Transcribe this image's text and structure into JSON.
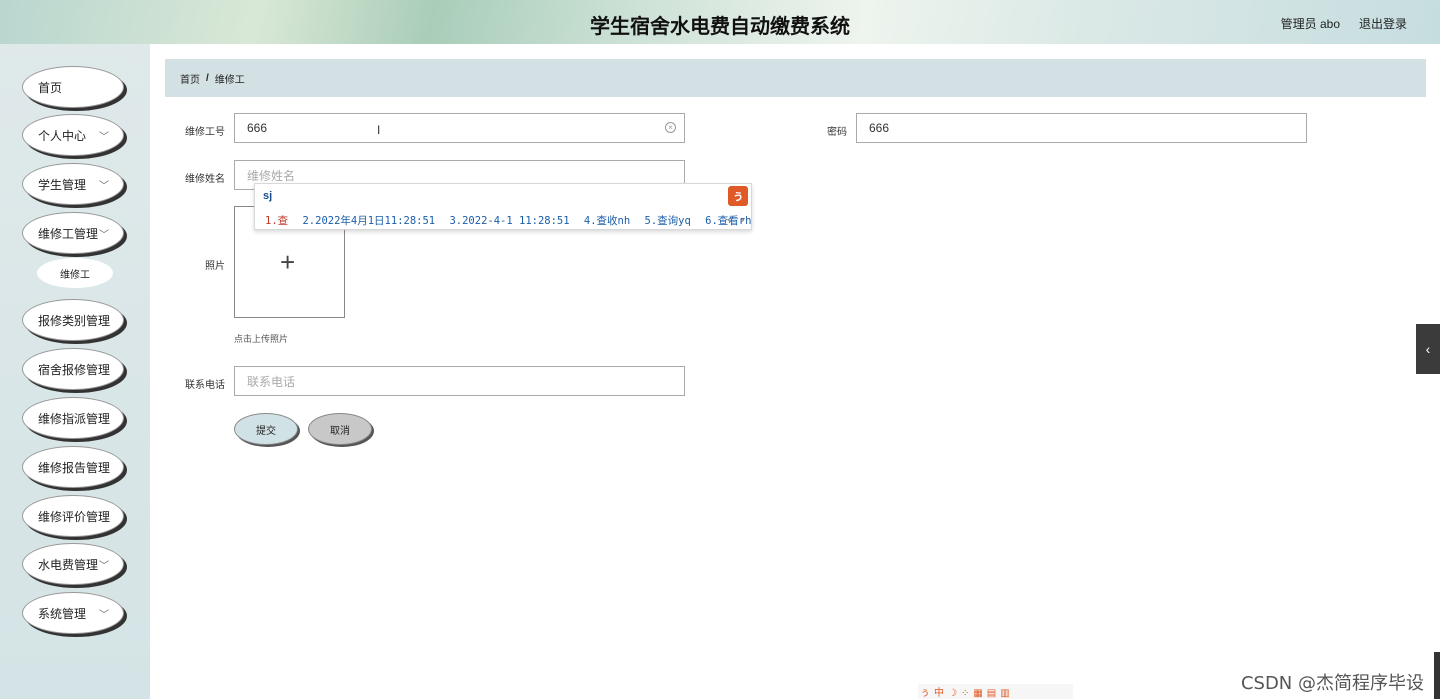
{
  "header": {
    "title": "学生宿舍水电费自动缴费系统",
    "user": "管理员 abo",
    "logout": "退出登录"
  },
  "sidebar": {
    "items": [
      {
        "label": "首页",
        "chevron": false
      },
      {
        "label": "个人中心",
        "chevron": true
      },
      {
        "label": "学生管理",
        "chevron": true
      },
      {
        "label": "维修工管理",
        "chevron": true
      },
      {
        "label": "报修类别管理",
        "chevron": false
      },
      {
        "label": "宿舍报修管理",
        "chevron": false
      },
      {
        "label": "维修指派管理",
        "chevron": false
      },
      {
        "label": "维修报告管理",
        "chevron": false
      },
      {
        "label": "维修评价管理",
        "chevron": false
      },
      {
        "label": "水电费管理",
        "chevron": true
      },
      {
        "label": "系统管理",
        "chevron": true
      }
    ],
    "sub_item": "维修工"
  },
  "breadcrumb": {
    "home": "首页",
    "separator": "/",
    "current": "维修工"
  },
  "form": {
    "worker_id_label": "维修工号",
    "worker_id_value": "666",
    "password_label": "密码",
    "password_value": "666",
    "worker_name_label": "维修姓名",
    "worker_name_placeholder": "维修姓名",
    "photo_label": "照片",
    "photo_hint": "点击上传照片",
    "phone_label": "联系电话",
    "phone_placeholder": "联系电话",
    "submit": "提交",
    "cancel": "取消"
  },
  "ime": {
    "input": "sj",
    "candidates": [
      "1.查",
      "2.2022年4月1日11:28:51",
      "3.2022-4-1 11:28:51",
      "4.查收nh",
      "5.查询yq",
      "6.查看rh"
    ],
    "nav": "‹ ›"
  },
  "watermark": "CSDN @杰简程序毕设",
  "colors": {
    "sidebar_bg": "#d4e3e5",
    "breadcrumb_bg": "#d3e1e4",
    "submit_bg": "#d1e2e6",
    "cancel_bg": "#c8c8c8",
    "ime_logo": "#e05a28"
  }
}
